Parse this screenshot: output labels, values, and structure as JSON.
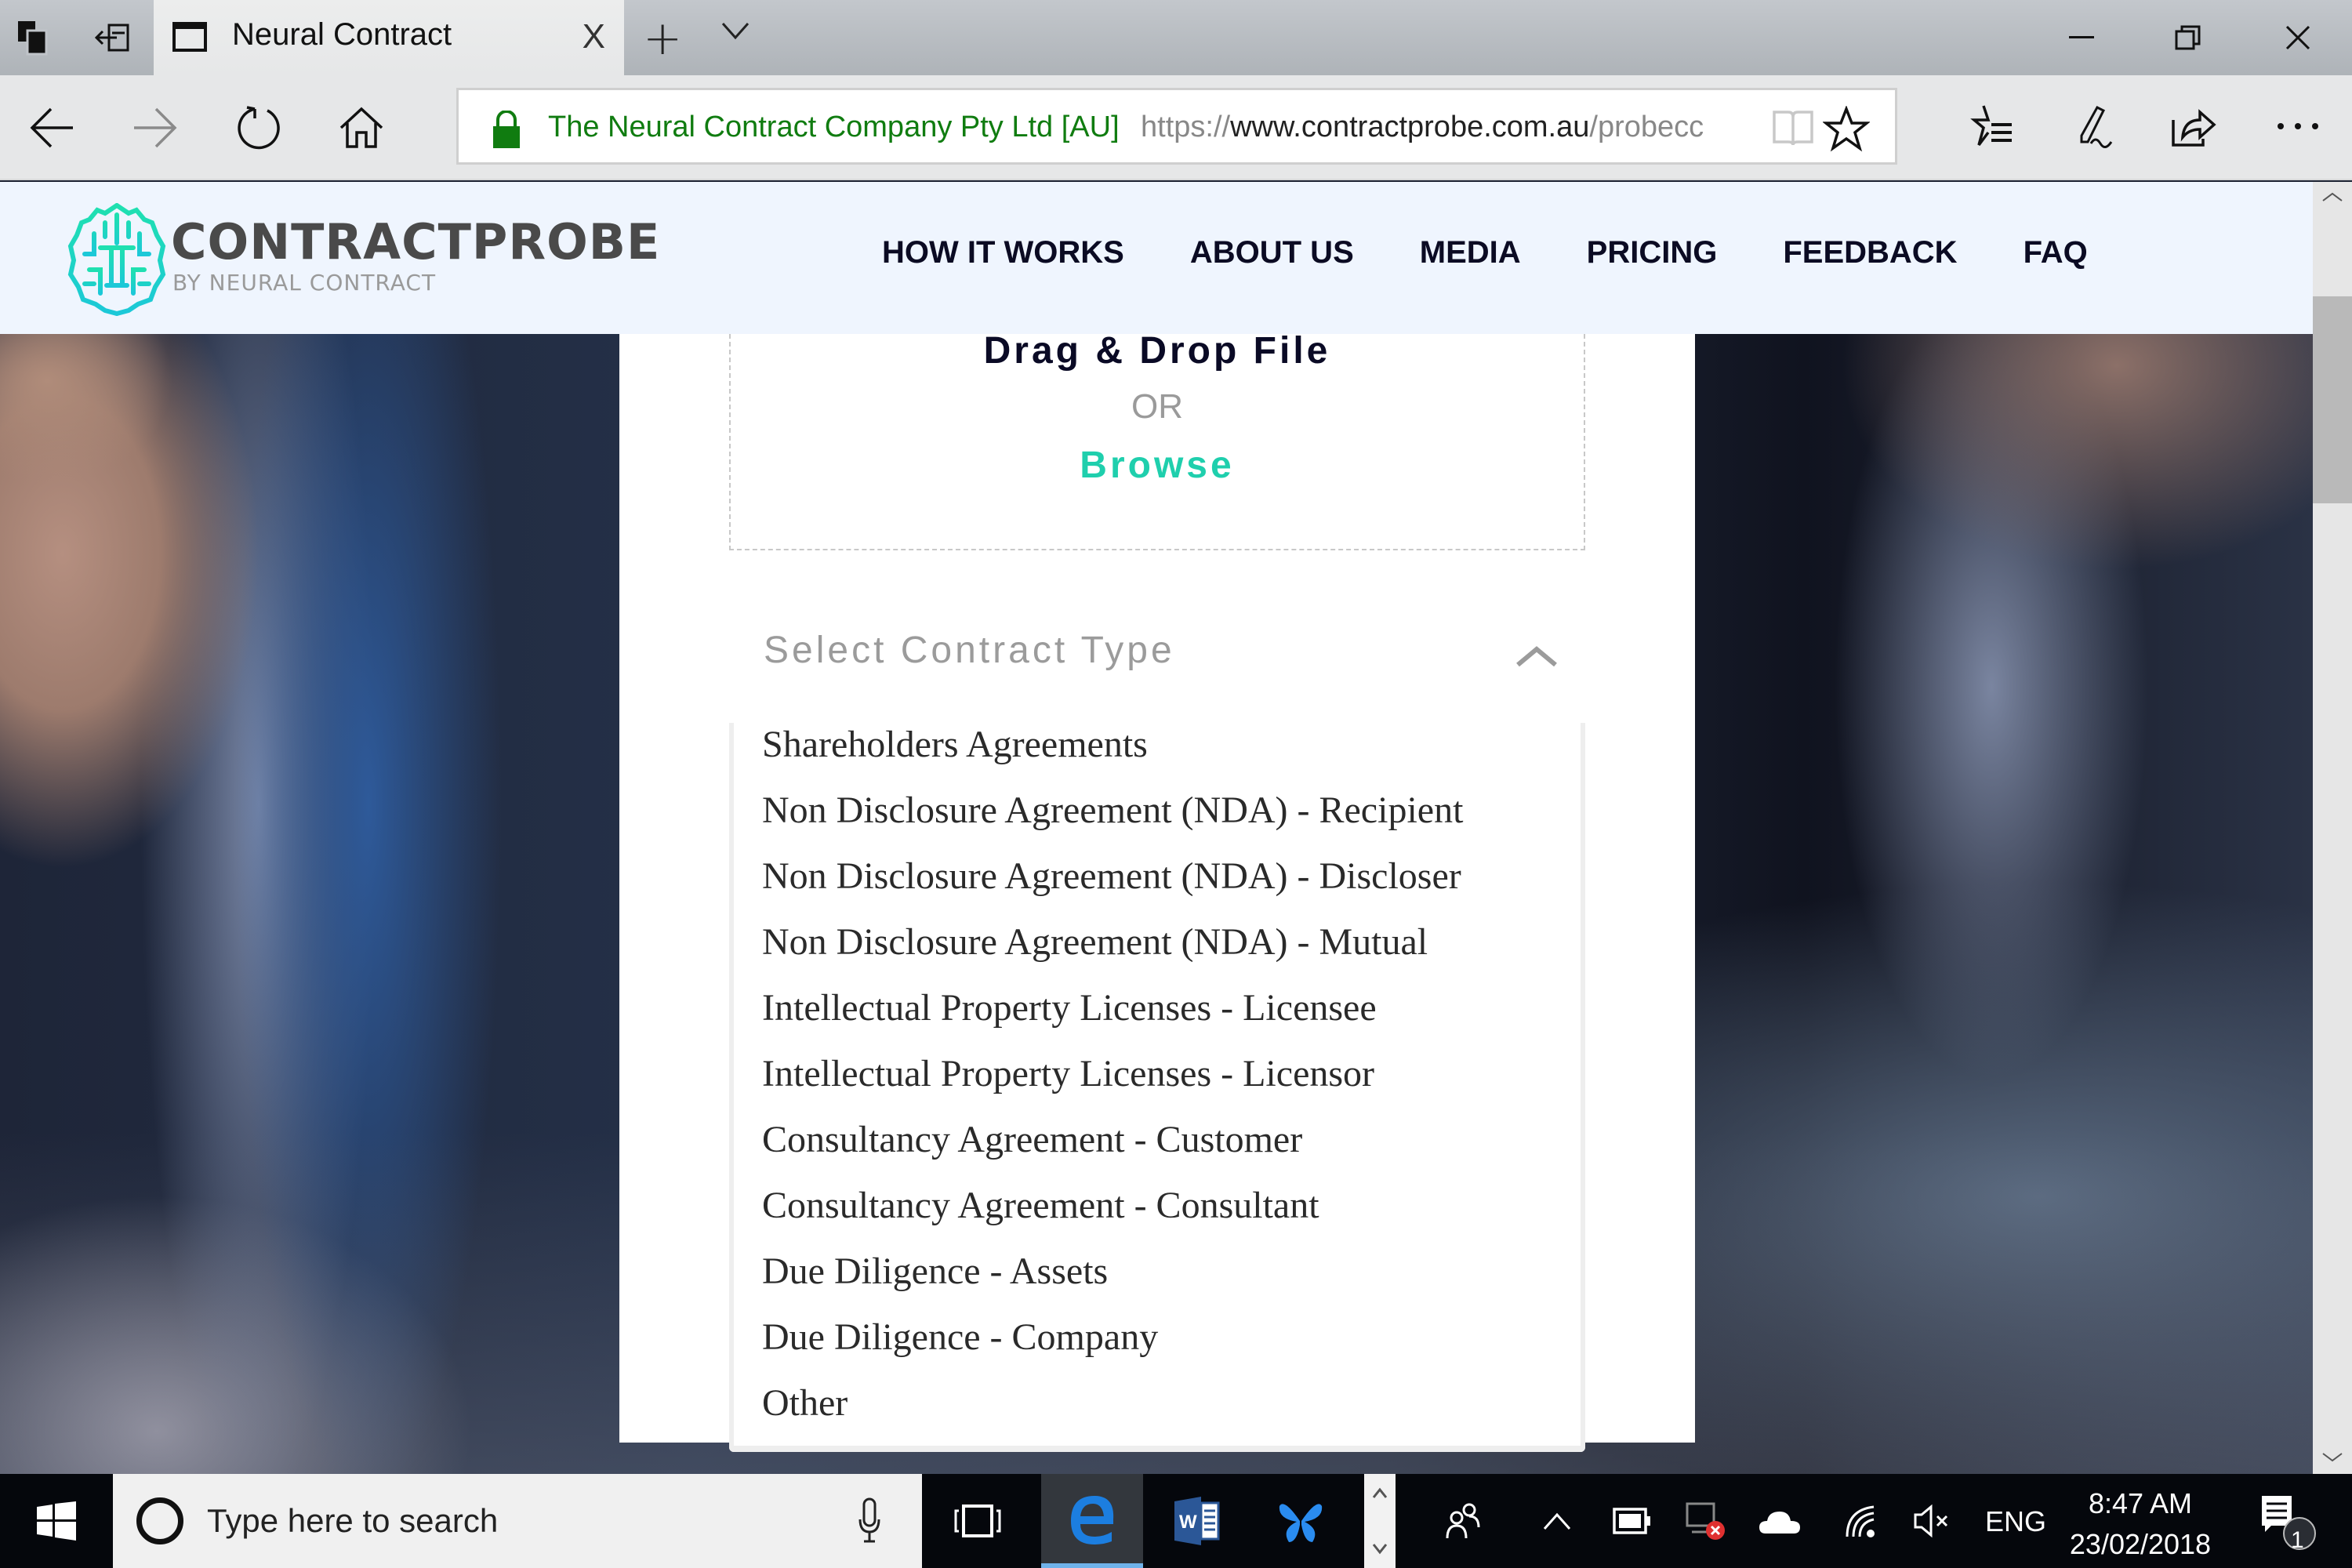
{
  "browser": {
    "tab_title": "Neural Contract",
    "tab_close": "X",
    "new_tab": "+",
    "address": {
      "org_name": "The Neural Contract Company Pty Ltd [AU]",
      "url_scheme": "https://",
      "url_host": "www.contractprobe.com.au",
      "url_path": "/probecc"
    },
    "window_controls": [
      "minimize",
      "restore",
      "close"
    ]
  },
  "site": {
    "brand": "CONTRACTPROBE",
    "tagline": "BY NEURAL CONTRACT",
    "brand_color": "#1fcfad",
    "nav": [
      {
        "label": "HOW IT WORKS"
      },
      {
        "label": "ABOUT US"
      },
      {
        "label": "MEDIA"
      },
      {
        "label": "PRICING"
      },
      {
        "label": "FEEDBACK"
      },
      {
        "label": "FAQ"
      }
    ]
  },
  "upload": {
    "drag_drop": "Drag & Drop File",
    "or": "OR",
    "browse": "Browse"
  },
  "contract_select": {
    "placeholder": "Select Contract Type",
    "expanded": true,
    "options": [
      "Shareholders Agreements",
      "Non Disclosure Agreement (NDA) - Recipient",
      "Non Disclosure Agreement (NDA) - Discloser",
      "Non Disclosure Agreement (NDA) - Mutual",
      "Intellectual Property Licenses - Licensee",
      "Intellectual Property Licenses - Licensor",
      "Consultancy Agreement - Customer",
      "Consultancy Agreement - Consultant",
      "Due Diligence - Assets",
      "Due Diligence - Company",
      "Other"
    ]
  },
  "taskbar": {
    "search_placeholder": "Type here to search",
    "language": "ENG",
    "time": "8:47 AM",
    "date": "23/02/2018",
    "notification_count": "1",
    "pinned_apps": [
      "task-view",
      "edge",
      "word",
      "butterfly-app"
    ]
  }
}
